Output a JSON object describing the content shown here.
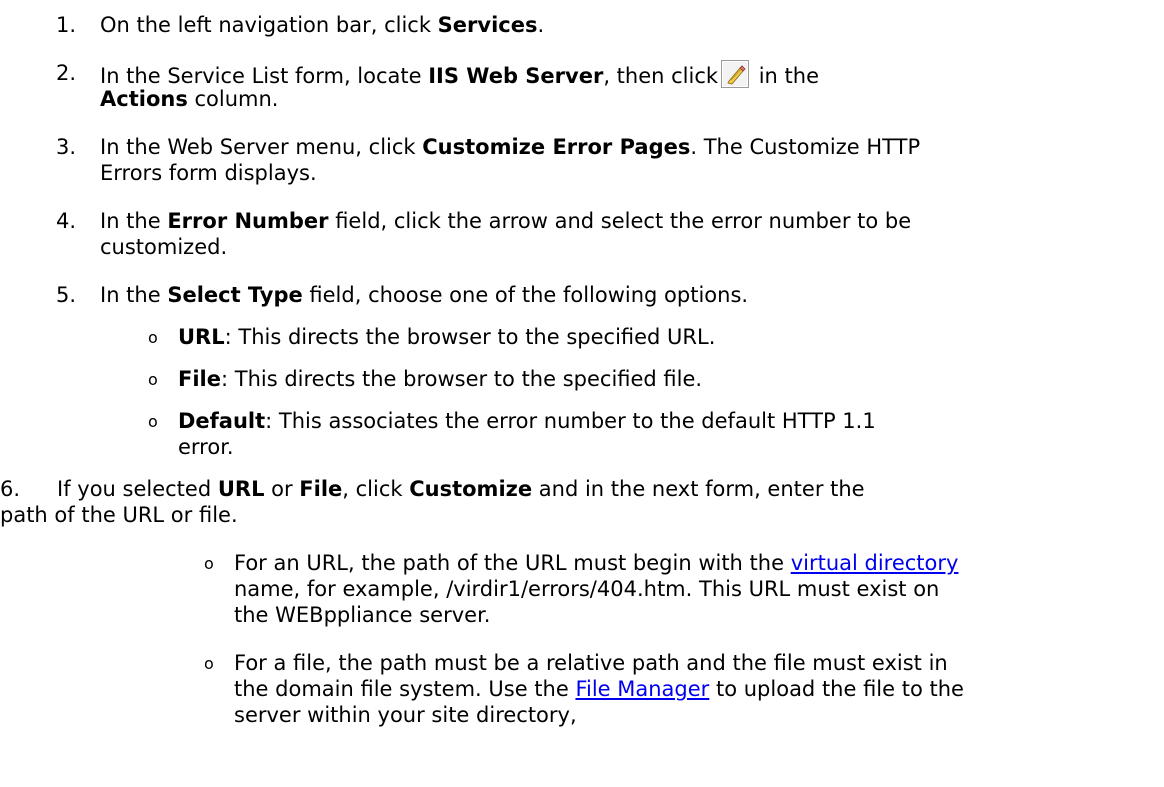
{
  "steps": [
    {
      "num": "1.",
      "a": "On the left navigation bar, click ",
      "b": "Services",
      "c": "."
    },
    {
      "num": "2.",
      "a": "In the Service List form, locate ",
      "b": "IIS Web Server",
      "c": ", then click",
      "d": " in the",
      "e": "Actions",
      "f": " column.",
      "icon": "edit-pencil-icon"
    },
    {
      "num": "3.",
      "a": "In the Web Server menu, click ",
      "b": "Customize Error Pages",
      "c": ". The Customize HTTP",
      "d": "Errors form displays."
    },
    {
      "num": "4.",
      "a": "In the ",
      "b": "Error Number",
      "c": " field, click the arrow and select the error number to be",
      "d": "customized."
    },
    {
      "num": "5.",
      "a": "In the ",
      "b": "Select Type",
      "c": " field, choose one of the following options."
    }
  ],
  "options": [
    {
      "bullet": "o",
      "label": "URL",
      "text": ": This directs the browser to the specified URL."
    },
    {
      "bullet": "o",
      "label": "File",
      "text": ": This directs the browser to the specified file."
    },
    {
      "bullet": "o",
      "label": "Default",
      "text": ": This associates the error number to the default HTTP 1.1",
      "text2": "error."
    }
  ],
  "step6": {
    "num": "6.",
    "a": "If you selected ",
    "b": "URL",
    "c": " or ",
    "d": "File",
    "e": ", click ",
    "f": "Customize",
    "g": " and in the next form, enter the",
    "h": "path of the URL or file."
  },
  "notes": [
    {
      "bullet": "o",
      "a": "For an URL, the path of the URL must begin with the ",
      "link": "virtual directory",
      "b": "name, for example, /virdir1/errors/404.htm. This URL must exist on",
      "c": "the WEBppliance server."
    },
    {
      "bullet": "o",
      "a": "For a file, the path must be a relative path and the file must exist in",
      "b": "the domain file system. Use the ",
      "link": "File Manager",
      "c": " to upload the file to the",
      "d": "server within your site directory,"
    }
  ]
}
